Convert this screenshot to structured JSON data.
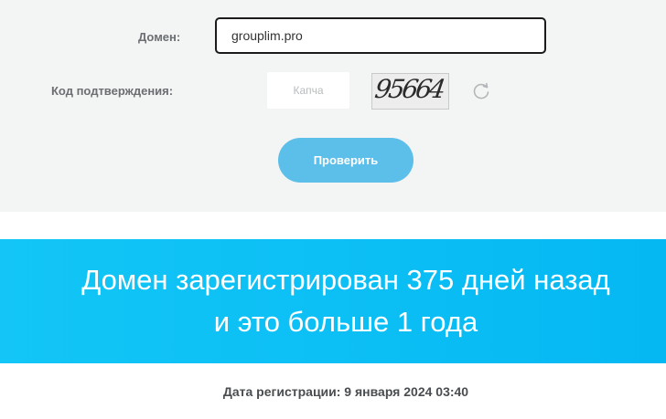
{
  "form": {
    "domain_label": "Домен:",
    "domain_value": "grouplim.pro",
    "code_label": "Код подтверждения:",
    "captcha_placeholder": "Капча",
    "captcha_image_text": "95664",
    "refresh_icon": "refresh-icon",
    "submit_label": "Проверить"
  },
  "result": {
    "line1": "Домен зарегистрирован 375 дней назад",
    "line2": "и это больше 1 года",
    "registration_date": "Дата регистрации: 9 января 2024 03:40"
  },
  "colors": {
    "panel_background": "#f3f4f4",
    "button": "#5bbfea",
    "banner": "#0bbff4",
    "input_border": "#1b1b1b"
  }
}
